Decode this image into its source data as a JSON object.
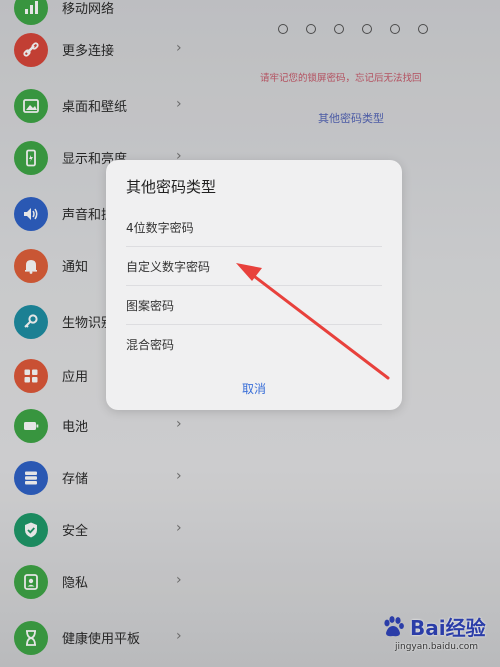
{
  "settings": {
    "items": [
      {
        "label": "移动网络",
        "color": "#3fa647",
        "icon": "signal-icon"
      },
      {
        "label": "更多连接",
        "color": "#d8473a",
        "icon": "link-icon"
      },
      {
        "label": "桌面和壁纸",
        "color": "#3fa647",
        "icon": "image-icon"
      },
      {
        "label": "显示和亮度",
        "color": "#3fa647",
        "icon": "phone-display-icon"
      },
      {
        "label": "声音和振动",
        "color": "#2f63c8",
        "icon": "speaker-icon"
      },
      {
        "label": "通知",
        "color": "#e0603a",
        "icon": "bell-icon"
      },
      {
        "label": "生物识别和密码",
        "color": "#1f8fa4",
        "icon": "key-icon"
      },
      {
        "label": "应用",
        "color": "#e05a3a",
        "icon": "grid-icon"
      },
      {
        "label": "电池",
        "color": "#3fa647",
        "icon": "battery-icon"
      },
      {
        "label": "存储",
        "color": "#2f63c8",
        "icon": "storage-icon"
      },
      {
        "label": "安全",
        "color": "#1f9a6a",
        "icon": "shield-icon"
      },
      {
        "label": "隐私",
        "color": "#3fa647",
        "icon": "privacy-icon"
      },
      {
        "label": "健康使用平板",
        "color": "#3fa647",
        "icon": "hourglass-icon"
      }
    ]
  },
  "pin_screen": {
    "warning": "请牢记您的锁屏密码，忘记后无法找回",
    "other_types_link": "其他密码类型"
  },
  "dialog": {
    "title": "其他密码类型",
    "options": [
      "4位数字密码",
      "自定义数字密码",
      "图案密码",
      "混合密码"
    ],
    "cancel": "取消"
  },
  "watermark": {
    "brand": "Bai经验",
    "site": "jingyan.baidu.com"
  },
  "colors": {
    "accent_blue": "#3a6fd8",
    "warning_red": "#c85a6a",
    "arrow_red": "#e8413c"
  }
}
